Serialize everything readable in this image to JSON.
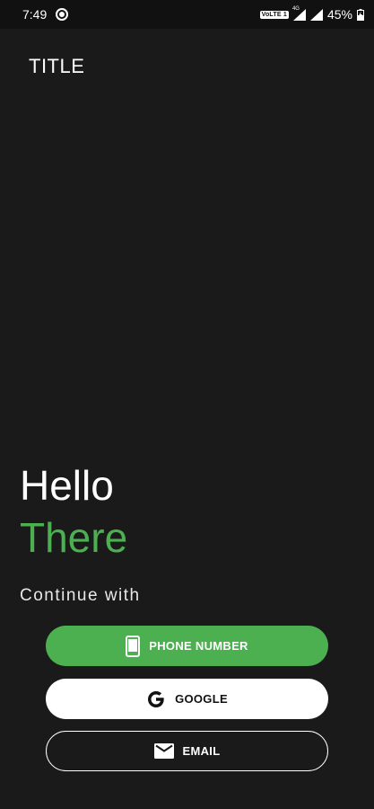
{
  "status_bar": {
    "time": "7:49",
    "network_badge": "VoLTE 1",
    "network_type": "4G",
    "battery": "45%"
  },
  "app": {
    "title": "TITLE"
  },
  "hero": {
    "line1": "Hello",
    "line2": "There",
    "subtitle": "Continue with"
  },
  "buttons": {
    "phone": {
      "label": "PHONE NUMBER",
      "icon": "phone-icon"
    },
    "google": {
      "label": "GOOGLE",
      "icon": "google-icon"
    },
    "email": {
      "label": "EMAIL",
      "icon": "mail-icon"
    }
  },
  "colors": {
    "background": "#1a1a1a",
    "accent": "#4caf50",
    "button_white": "#ffffff"
  }
}
